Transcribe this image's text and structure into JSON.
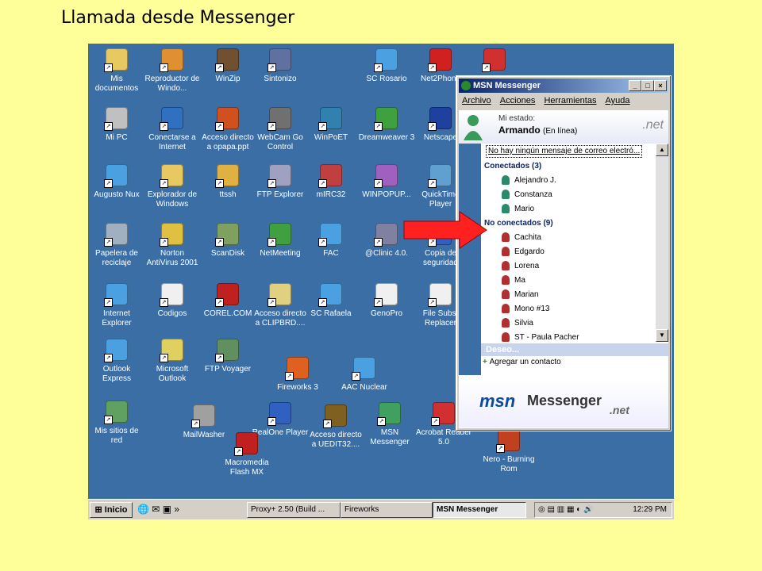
{
  "slide": {
    "title": "Llamada desde Messenger"
  },
  "desktop_icons": [
    {
      "label": "Mis documentos",
      "icon": "my-documents-icon",
      "color": "#e8c860"
    },
    {
      "label": "Reproductor de Windo...",
      "icon": "media-player-icon",
      "color": "#e09030"
    },
    {
      "label": "WinZip",
      "icon": "winzip-icon",
      "color": "#705030"
    },
    {
      "label": "Sintonizo",
      "icon": "sintonizo-icon",
      "color": "#6070a0"
    },
    {
      "label": "SC Rosario",
      "icon": "ie-icon",
      "color": "#4aa0e0"
    },
    {
      "label": "Net2Phone",
      "icon": "net2phone-icon",
      "color": "#d02020"
    },
    {
      "label": "",
      "icon": "acrobat-icon",
      "color": "#d03030"
    },
    {
      "label": "Mi PC",
      "icon": "my-computer-icon",
      "color": "#c0c0c0"
    },
    {
      "label": "Conectarse a Internet",
      "icon": "connect-internet-icon",
      "color": "#3070c0"
    },
    {
      "label": "Acceso directo a opapa.ppt",
      "icon": "ppt-icon",
      "color": "#d05020"
    },
    {
      "label": "WebCam Go Control",
      "icon": "webcam-icon",
      "color": "#707070"
    },
    {
      "label": "WinPoET",
      "icon": "winpoet-icon",
      "color": "#3080b0"
    },
    {
      "label": "Dreamweaver 3",
      "icon": "dreamweaver-icon",
      "color": "#40a040"
    },
    {
      "label": "Netscape",
      "icon": "netscape-icon",
      "color": "#2040a0"
    },
    {
      "label": "Augusto Nux",
      "icon": "ie-icon",
      "color": "#4aa0e0"
    },
    {
      "label": "Explorador de Windows",
      "icon": "explorer-icon",
      "color": "#e8c860"
    },
    {
      "label": "ttssh",
      "icon": "ttssh-icon",
      "color": "#e0b040"
    },
    {
      "label": "FTP Explorer",
      "icon": "ftp-explorer-icon",
      "color": "#a0a0c0"
    },
    {
      "label": "mIRC32",
      "icon": "mirc-icon",
      "color": "#c04040"
    },
    {
      "label": "WINPOPUP...",
      "icon": "winpopup-icon",
      "color": "#a060c0"
    },
    {
      "label": "QuickTime Player",
      "icon": "quicktime-icon",
      "color": "#60a0d0"
    },
    {
      "label": "Papelera de reciclaje",
      "icon": "recycle-bin-icon",
      "color": "#a0b0c0"
    },
    {
      "label": "Norton AntiVirus 2001",
      "icon": "norton-icon",
      "color": "#e0c040"
    },
    {
      "label": "ScanDisk",
      "icon": "scandisk-icon",
      "color": "#80a060"
    },
    {
      "label": "NetMeeting",
      "icon": "netmeeting-icon",
      "color": "#40a040"
    },
    {
      "label": "FAC",
      "icon": "ie-icon",
      "color": "#4aa0e0"
    },
    {
      "label": "@Clinic 4.0.",
      "icon": "clinic-icon",
      "color": "#8080a0"
    },
    {
      "label": "Copia de seguridad",
      "icon": "word-icon",
      "color": "#3060c0"
    },
    {
      "label": "Internet Explorer",
      "icon": "ie-icon",
      "color": "#4aa0e0"
    },
    {
      "label": "Codigos",
      "icon": "text-file-icon",
      "color": "#f0f0f0"
    },
    {
      "label": "COREL.COM",
      "icon": "corel-icon",
      "color": "#c02020"
    },
    {
      "label": "Acceso directo a CLIPBRD....",
      "icon": "clipboard-icon",
      "color": "#e0d080"
    },
    {
      "label": "SC Rafaela",
      "icon": "ie-icon",
      "color": "#4aa0e0"
    },
    {
      "label": "GenoPro",
      "icon": "genopro-icon",
      "color": "#f0f0f0"
    },
    {
      "label": "File Subst Replacer",
      "icon": "file-replace-icon",
      "color": "#f0f0f0"
    },
    {
      "label": "Outlook Express",
      "icon": "outlook-express-icon",
      "color": "#4aa0e0"
    },
    {
      "label": "Microsoft Outlook",
      "icon": "outlook-icon",
      "color": "#e0d060"
    },
    {
      "label": "FTP Voyager",
      "icon": "ftp-voyager-icon",
      "color": "#609060"
    },
    {
      "label": "Fireworks 3",
      "icon": "fireworks-icon",
      "color": "#e06020"
    },
    {
      "label": "AAC Nuclear",
      "icon": "ie-icon",
      "color": "#4aa0e0"
    },
    {
      "label": "Mis sitios de red",
      "icon": "network-places-icon",
      "color": "#60a060"
    },
    {
      "label": "MailWasher",
      "icon": "mailwasher-icon",
      "color": "#a0a0a0"
    },
    {
      "label": "RealOne Player",
      "icon": "realone-icon",
      "color": "#3060c0"
    },
    {
      "label": "Acceso directo a UEDIT32....",
      "icon": "ultraedit-icon",
      "color": "#806020"
    },
    {
      "label": "MSN Messenger",
      "icon": "msn-messenger-icon",
      "color": "#40a060"
    },
    {
      "label": "Acrobat Reader 5.0",
      "icon": "acrobat-icon",
      "color": "#d03030"
    },
    {
      "label": "Nero - Burning Rom",
      "icon": "nero-icon",
      "color": "#c04020"
    },
    {
      "label": "Macromedia Flash MX",
      "icon": "flash-icon",
      "color": "#c02020"
    }
  ],
  "msn": {
    "title": "MSN Messenger",
    "menu": [
      "Archivo",
      "Acciones",
      "Herramientas",
      "Ayuda"
    ],
    "mi_estado": "Mi estado:",
    "user_name": "Armando",
    "user_status": "(En línea)",
    "net_logo": ".net",
    "mail_notice": "No hay ningún mensaje de correo electró...",
    "online_group": "Conectados (3)",
    "online_contacts": [
      "Alejandro J.",
      "Constanza",
      "Mario"
    ],
    "offline_group": "No conectados (9)",
    "offline_contacts": [
      "Cachita",
      "Edgardo",
      "Lorena",
      "Ma",
      "Marian",
      "Mono #13",
      "Silvia",
      "ST - Paula Pacher"
    ],
    "deseo": "Deseo...",
    "add_contact": "Agregar un contacto",
    "banner_msn": "msn",
    "banner_messenger": "Messenger",
    "banner_net": ".net"
  },
  "taskbar": {
    "start": "Inicio",
    "items": [
      "Proxy+ 2.50 (Build ...",
      "Fireworks",
      "MSN Messenger"
    ],
    "clock": "12:29 PM"
  },
  "colors": {
    "desktop": "#3a6ea5",
    "slide_bg": "#ffff99",
    "arrow": "#ff2020"
  }
}
